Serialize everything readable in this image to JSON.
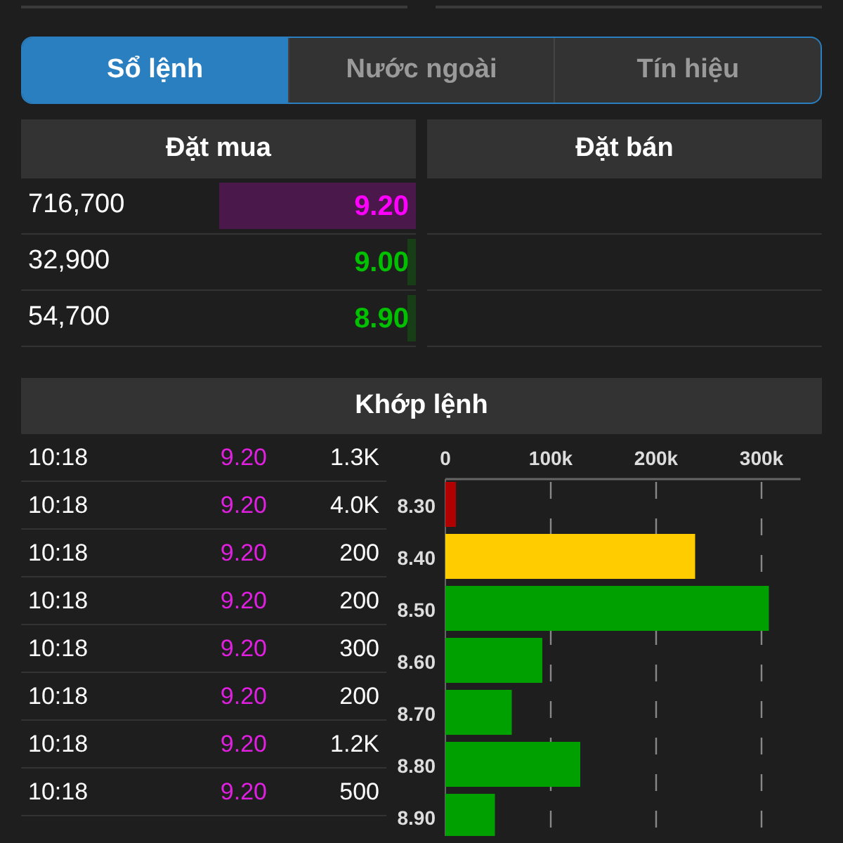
{
  "tabs": [
    {
      "label": "Sổ lệnh",
      "selected": true
    },
    {
      "label": "Nước ngoài",
      "selected": false
    },
    {
      "label": "Tín hiệu",
      "selected": false
    }
  ],
  "order_book": {
    "bid_header": "Đặt mua",
    "ask_header": "Đặt bán",
    "bids": [
      {
        "volume": "716,700",
        "price": "9.20",
        "color": "#ff00ff",
        "level": 0.5
      },
      {
        "volume": "32,900",
        "price": "9.00",
        "color": "#00c000",
        "level": 0.02
      },
      {
        "volume": "54,700",
        "price": "8.90",
        "color": "#00c000",
        "level": 0.02
      }
    ]
  },
  "matched": {
    "title": "Khớp lệnh",
    "trades": [
      {
        "time": "10:18",
        "price": "9.20",
        "volume": "1.3K"
      },
      {
        "time": "10:18",
        "price": "9.20",
        "volume": "4.0K"
      },
      {
        "time": "10:18",
        "price": "9.20",
        "volume": "200"
      },
      {
        "time": "10:18",
        "price": "9.20",
        "volume": "200"
      },
      {
        "time": "10:18",
        "price": "9.20",
        "volume": "300"
      },
      {
        "time": "10:18",
        "price": "9.20",
        "volume": "200"
      },
      {
        "time": "10:18",
        "price": "9.20",
        "volume": "1.2K"
      },
      {
        "time": "10:18",
        "price": "9.20",
        "volume": "500"
      }
    ],
    "chart_data": {
      "type": "bar",
      "orientation": "horizontal",
      "categories": [
        "8.30",
        "8.40",
        "8.50",
        "8.60",
        "8.70",
        "8.80",
        "8.90"
      ],
      "grid": true,
      "series": [
        {
          "color": "#b00000",
          "values": [
            10000,
            null,
            null,
            null,
            null,
            null,
            null
          ]
        },
        {
          "color": "#ffcc00",
          "values": [
            null,
            237000,
            null,
            null,
            null,
            null,
            null
          ]
        },
        {
          "color": "#00a000",
          "values": [
            null,
            null,
            307000,
            92000,
            63000,
            128000,
            47000
          ]
        }
      ],
      "xlim": [
        0,
        337000
      ],
      "xticks": [
        {
          "value": 0,
          "label": "0"
        },
        {
          "value": 100000,
          "label": "100k"
        },
        {
          "value": 200000,
          "label": "200k"
        },
        {
          "value": 300000,
          "label": "300k"
        }
      ]
    }
  }
}
